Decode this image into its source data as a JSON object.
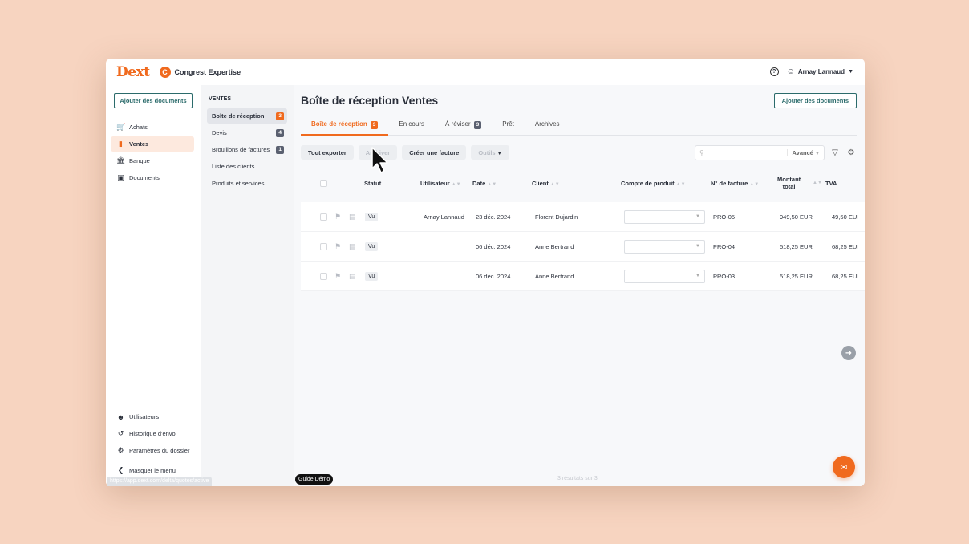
{
  "app": {
    "logo": "Dext",
    "org_initial": "C",
    "org_name": "Congrest Expertise",
    "help_icon": "question-circle-icon",
    "user_name": "Arnay Lannaud"
  },
  "sidebar": {
    "add_button": "Ajouter des documents",
    "items": [
      {
        "label": "Achats",
        "icon": "cart-icon"
      },
      {
        "label": "Ventes",
        "icon": "card-icon",
        "active": true
      },
      {
        "label": "Banque",
        "icon": "bank-icon"
      },
      {
        "label": "Documents",
        "icon": "document-icon"
      }
    ],
    "bottom_items": [
      {
        "label": "Utilisateurs",
        "icon": "users-icon"
      },
      {
        "label": "Historique d'envoi",
        "icon": "history-icon"
      },
      {
        "label": "Paramètres du dossier",
        "icon": "gear-icon"
      }
    ],
    "collapse": "Masquer le menu"
  },
  "subnav": {
    "title": "VENTES",
    "items": [
      {
        "label": "Boîte de réception",
        "count": "3",
        "active": true
      },
      {
        "label": "Devis",
        "count": "4"
      },
      {
        "label": "Brouillons de factures",
        "count": "1"
      },
      {
        "label": "Liste des clients"
      },
      {
        "label": "Produits et services"
      }
    ]
  },
  "main": {
    "title": "Boîte de réception Ventes",
    "add_button": "Ajouter des documents",
    "tabs": [
      {
        "label": "Boîte de réception",
        "count": "3",
        "active": true
      },
      {
        "label": "En cours"
      },
      {
        "label": "À réviser",
        "count": "3"
      },
      {
        "label": "Prêt"
      },
      {
        "label": "Archives"
      }
    ],
    "toolbar": {
      "export": "Tout exporter",
      "archive": "Archiver",
      "create": "Créer une facture",
      "tools": "Outils",
      "search_placeholder": "",
      "advanced": "Avancé"
    },
    "columns": {
      "status": "Statut",
      "user": "Utilisateur",
      "date": "Date",
      "client": "Client",
      "account": "Compte de produit",
      "invoice": "N° de facture",
      "amount_1": "Montant",
      "amount_2": "total",
      "vat": "TVA"
    },
    "rows": [
      {
        "status": "Vu",
        "user": "Arnay Lannaud",
        "date": "23 déc. 2024",
        "client": "Florent Dujardin",
        "invoice": "PRO-05",
        "amount": "949,50 EUR",
        "vat": "49,50 EUI"
      },
      {
        "status": "Vu",
        "user": "",
        "date": "06 déc. 2024",
        "client": "Anne Bertrand",
        "invoice": "PRO-04",
        "amount": "518,25 EUR",
        "vat": "68,25 EUI"
      },
      {
        "status": "Vu",
        "user": "",
        "date": "06 déc. 2024",
        "client": "Anne Bertrand",
        "invoice": "PRO-03",
        "amount": "518,25 EUR",
        "vat": "68,25 EUI"
      }
    ],
    "pager": "3 résultats sur 3"
  },
  "overlay": {
    "status_url": "https://app.dext.com/delta/quotes/active",
    "guide": "Guide Démo"
  },
  "colors": {
    "accent": "#f06a1e",
    "primary_outline": "#2b6b6b"
  }
}
